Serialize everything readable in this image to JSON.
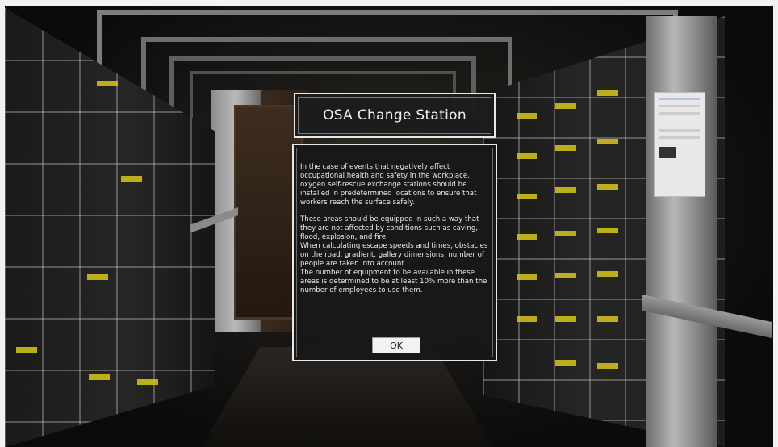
{
  "dialog": {
    "title": "OSA Change Station",
    "paragraphs": [
      "In the case of events that negatively affect occupational health and safety in the workplace, oxygen self-rescue exchange stations should be installed in predetermined locations to ensure that workers reach the surface safely.",
      "These areas should be equipped in such a way that they are not affected by conditions such as caving, flood, explosion, and fire.\nWhen calculating escape speeds and times, obstacles on the road, gradient, gallery dimensions, number of people are taken into account.\nThe number of equipment to be available in these areas is determined to be at least 10% more than the number of employees to use them."
    ],
    "ok_label": "OK"
  },
  "colors": {
    "dialog_bg": "#181818",
    "dialog_border": "#e8e8e8",
    "label_tag": "#d7c81a"
  }
}
